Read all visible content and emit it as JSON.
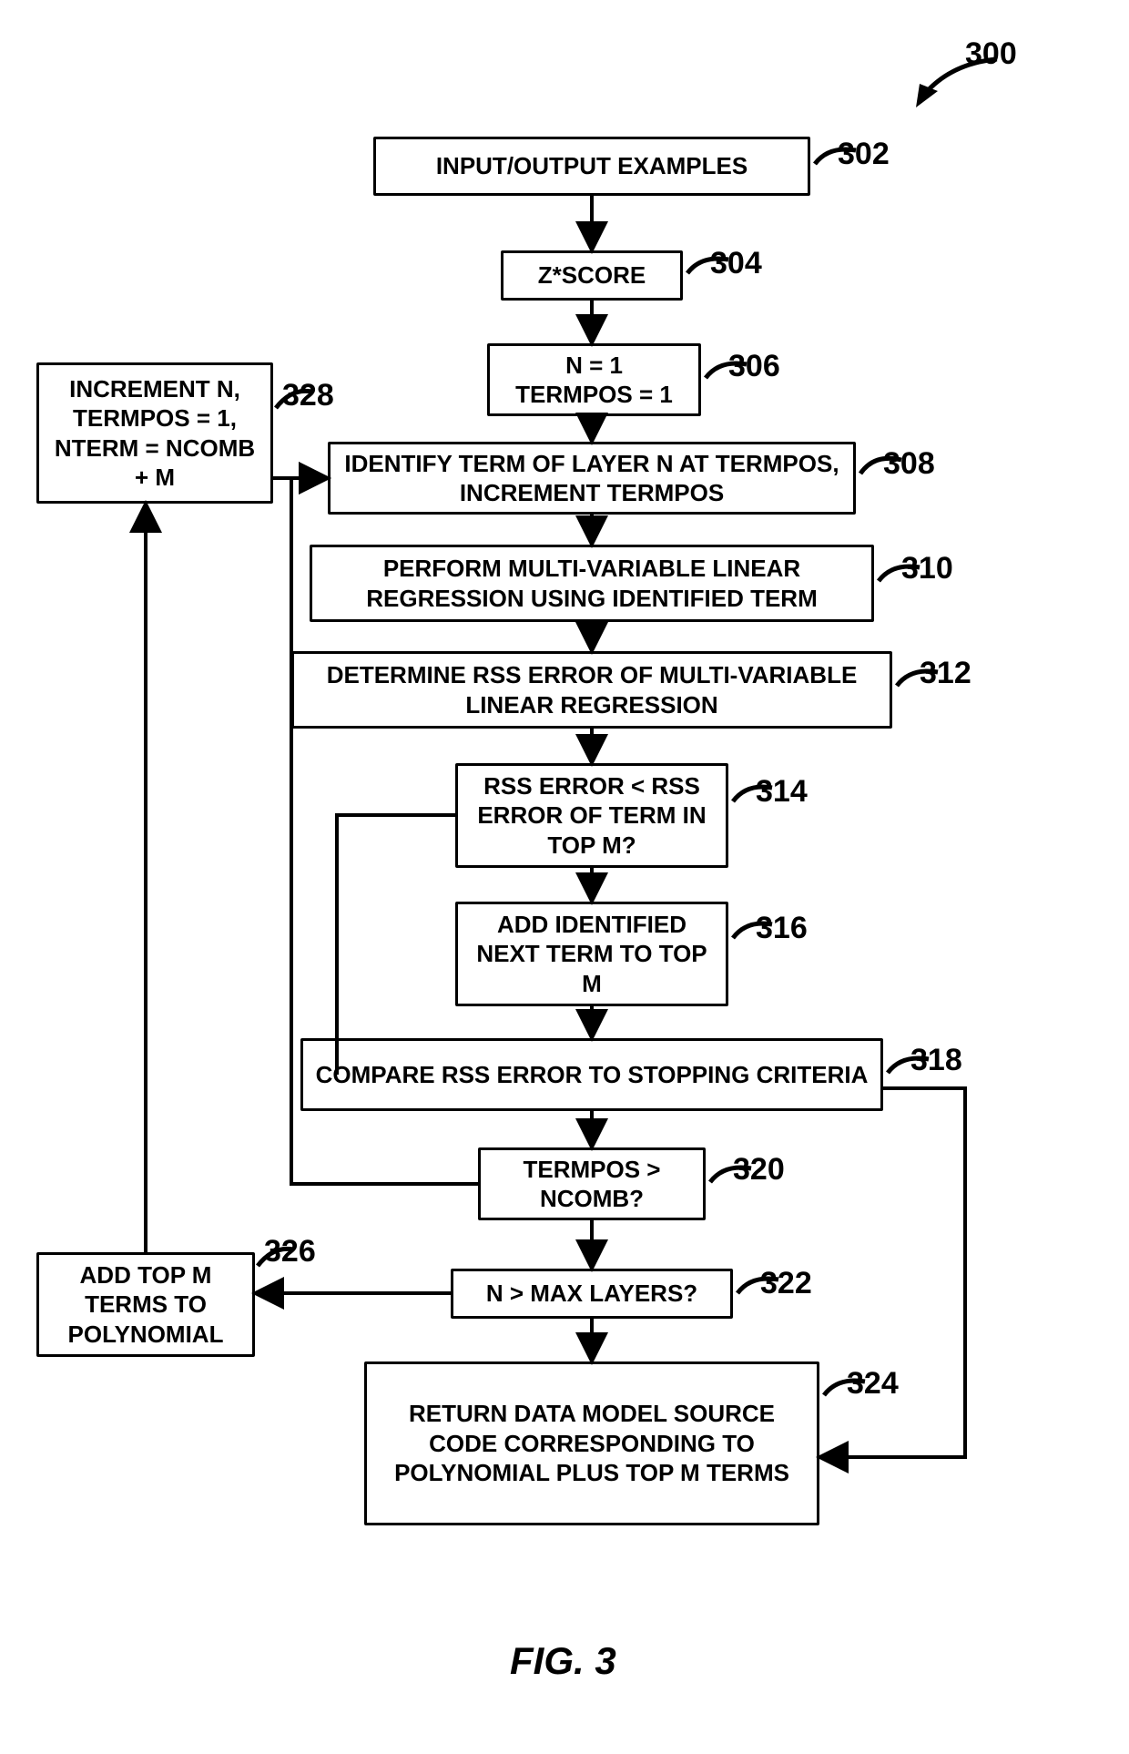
{
  "title_ref": "300",
  "figure_caption": "FIG. 3",
  "nodes": {
    "n302": {
      "ref": "302",
      "text": "INPUT/OUTPUT EXAMPLES"
    },
    "n304": {
      "ref": "304",
      "text": "Z*SCORE"
    },
    "n306": {
      "ref": "306",
      "text": "N = 1\nTERMPOS = 1"
    },
    "n308": {
      "ref": "308",
      "text": "IDENTIFY TERM OF LAYER N AT TERMPOS, INCREMENT TERMPOS"
    },
    "n310": {
      "ref": "310",
      "text": "PERFORM MULTI-VARIABLE LINEAR REGRESSION USING IDENTIFIED TERM"
    },
    "n312": {
      "ref": "312",
      "text": "DETERMINE RSS ERROR OF MULTI-VARIABLE LINEAR REGRESSION"
    },
    "n314": {
      "ref": "314",
      "text": "RSS ERROR < RSS ERROR OF TERM IN TOP M?"
    },
    "n316": {
      "ref": "316",
      "text": "ADD IDENTIFIED NEXT TERM TO TOP M"
    },
    "n318": {
      "ref": "318",
      "text": "COMPARE RSS ERROR TO STOPPING CRITERIA"
    },
    "n320": {
      "ref": "320",
      "text": "TERMPOS > NCOMB?"
    },
    "n322": {
      "ref": "322",
      "text": "N > MAX LAYERS?"
    },
    "n324": {
      "ref": "324",
      "text": "RETURN DATA MODEL SOURCE CODE CORRESPONDING TO POLYNOMIAL PLUS TOP M TERMS"
    },
    "n326": {
      "ref": "326",
      "text": "ADD TOP M TERMS TO POLYNOMIAL"
    },
    "n328": {
      "ref": "328",
      "text": "INCREMENT N, TERMPOS = 1, NTERM = NCOMB + M"
    }
  }
}
